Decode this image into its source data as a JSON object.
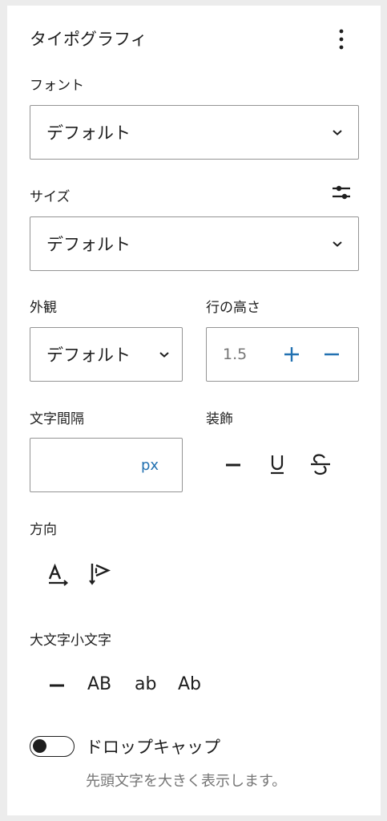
{
  "panel": {
    "title": "タイポグラフィ",
    "menu_icon": "vertical-ellipsis-icon"
  },
  "font": {
    "label": "フォント",
    "value": "デフォルト"
  },
  "size": {
    "label": "サイズ",
    "value": "デフォルト",
    "custom_icon": "sliders-icon"
  },
  "appearance": {
    "label": "外観",
    "value": "デフォルト"
  },
  "line_height": {
    "label": "行の高さ",
    "value": "1.5",
    "increment_icon": "plus-icon",
    "decrement_icon": "minus-icon"
  },
  "letter_spacing": {
    "label": "文字間隔",
    "value": "",
    "unit": "px"
  },
  "decoration": {
    "label": "装飾",
    "options": [
      "none-icon",
      "underline-icon",
      "strikethrough-icon"
    ]
  },
  "orientation": {
    "label": "方向",
    "options": [
      "horizontal-text-icon",
      "vertical-text-icon"
    ]
  },
  "letter_case": {
    "label": "大文字小文字",
    "none_icon": "minus-icon",
    "uppercase": "AB",
    "lowercase": "ab",
    "capitalize": "Ab"
  },
  "drop_cap": {
    "label": "ドロップキャップ",
    "help": "先頭文字を大きく表示します。",
    "enabled": false
  },
  "colors": {
    "accent": "#2271b1",
    "border": "#949494",
    "text": "#1e1e1e",
    "muted": "#757575"
  }
}
